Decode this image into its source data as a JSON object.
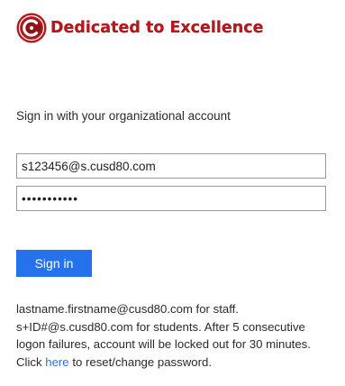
{
  "header": {
    "title": "Dedicated to Excellence",
    "logo_icon": "district-seal-icon",
    "brand_color": "#b3191c"
  },
  "form": {
    "prompt": "Sign in with your organizational account",
    "email_value": "s123456@s.cusd80.com",
    "password_value": "•••••••••••",
    "signin_label": "Sign in",
    "button_color": "#2672ec"
  },
  "help": {
    "text_before": "lastname.firstname@cusd80.com for staff. s+ID#@s.cusd80.com for students. After 5 consecutive logon failures, account will be locked out for 30 minutes. Click ",
    "link_text": "here",
    "text_after": " to reset/change password.",
    "link_color": "#2672ec"
  }
}
